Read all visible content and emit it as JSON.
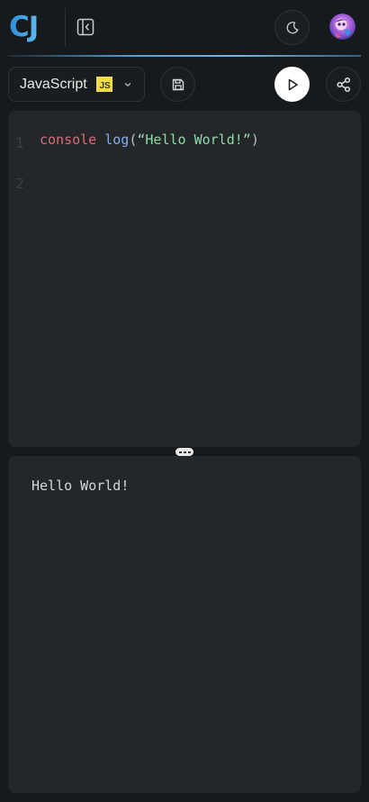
{
  "header": {
    "logo_text": "CJ",
    "logo_color": "#3aa0e6"
  },
  "toolbar": {
    "language_label": "JavaScript",
    "language_badge": "JS",
    "badge_color": "#f0db4f",
    "save_icon": "save-icon",
    "run_icon": "play-icon",
    "share_icon": "share-icon"
  },
  "editor": {
    "line_numbers": [
      "1",
      "2"
    ],
    "line1": {
      "object": "console",
      "dot": " ",
      "method": "log",
      "open": "(",
      "string": "“Hello World!”",
      "close": ")"
    }
  },
  "output": {
    "text": "Hello World!"
  }
}
